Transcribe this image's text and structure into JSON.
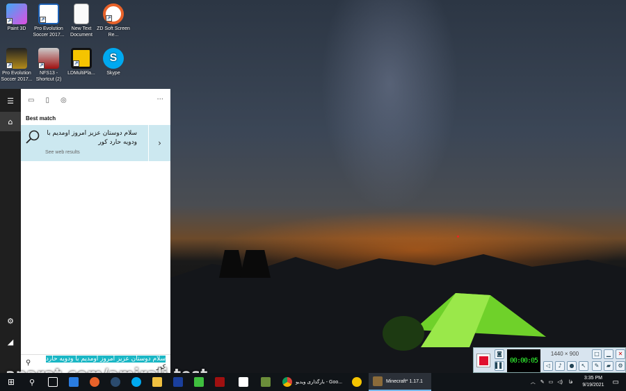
{
  "desktop": {
    "icons": [
      {
        "label": "Paint 3D"
      },
      {
        "label": "Pro Evolution Soccer 2017..."
      },
      {
        "label": "New Text Document"
      },
      {
        "label": "ZD Soft Screen Re..."
      },
      {
        "label": "Pro Evolution Soccer 2017..."
      },
      {
        "label": "NFS13 - Shortcut (2)"
      },
      {
        "label": "LDMultiPla..."
      },
      {
        "label": "Skype"
      }
    ]
  },
  "start_menu": {
    "rail": {
      "menu_icon": "hamburger-icon",
      "home_icon": "home-icon",
      "settings_icon": "gear-icon",
      "user_icon": "user-icon"
    },
    "tabs": {
      "more_label": "···"
    },
    "best_match_title": "Best match",
    "result": {
      "title_line1": "سلام دوستان عزیز امروز اومدیم با",
      "title_line2": "ودویه حارد کور",
      "subtitle": "See web results"
    },
    "search": {
      "query_highlighted": "سلام دوستان عزیز امروز اومدیم با ودویه حارد",
      "query_rest": "کور"
    }
  },
  "watermark": "aparat.com/amirali.test",
  "taskbar": {
    "apps": [
      {
        "label": "بارگذاری ویدیو - Goo..."
      },
      {
        "label": "Minecraft* 1.17.1"
      }
    ],
    "lang": "فا",
    "time": "3:35 PM",
    "date": "9/19/2021"
  },
  "recorder": {
    "timer": "00:00:05",
    "resolution": "1440 × 900"
  },
  "colors": {
    "highlight": "#cce8f0",
    "search_highlight": "#1bb7c5",
    "record": "#e0102e"
  }
}
